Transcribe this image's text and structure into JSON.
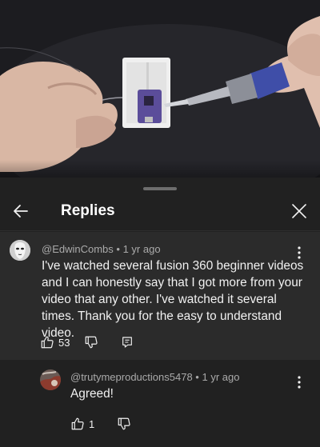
{
  "header": {
    "title": "Replies",
    "back_icon": "back-arrow-icon",
    "close_icon": "close-icon"
  },
  "comment": {
    "author": "@EdwinCombs",
    "time": "1 yr ago",
    "separator": "•",
    "text": "I've watched several fusion 360 beginner videos and I can honestly say that I got more from your video that any other. I've watched it several times. Thank you for the easy to understand video.",
    "likes": "53",
    "icons": [
      "thumbs-up-icon",
      "thumbs-down-icon",
      "reply-icon",
      "more-vert-icon"
    ]
  },
  "reply": {
    "author": "@trutymeproductions5478",
    "time": "1 yr ago",
    "separator": "•",
    "text": "Agreed!",
    "likes": "1",
    "icons": [
      "thumbs-up-icon",
      "thumbs-down-icon",
      "more-vert-icon"
    ]
  },
  "colors": {
    "sheet_bg": "#212121",
    "highlighted_comment_bg": "#2b2b2b",
    "primary_text": "#f1f1f1",
    "secondary_text": "#aaaaaa"
  }
}
